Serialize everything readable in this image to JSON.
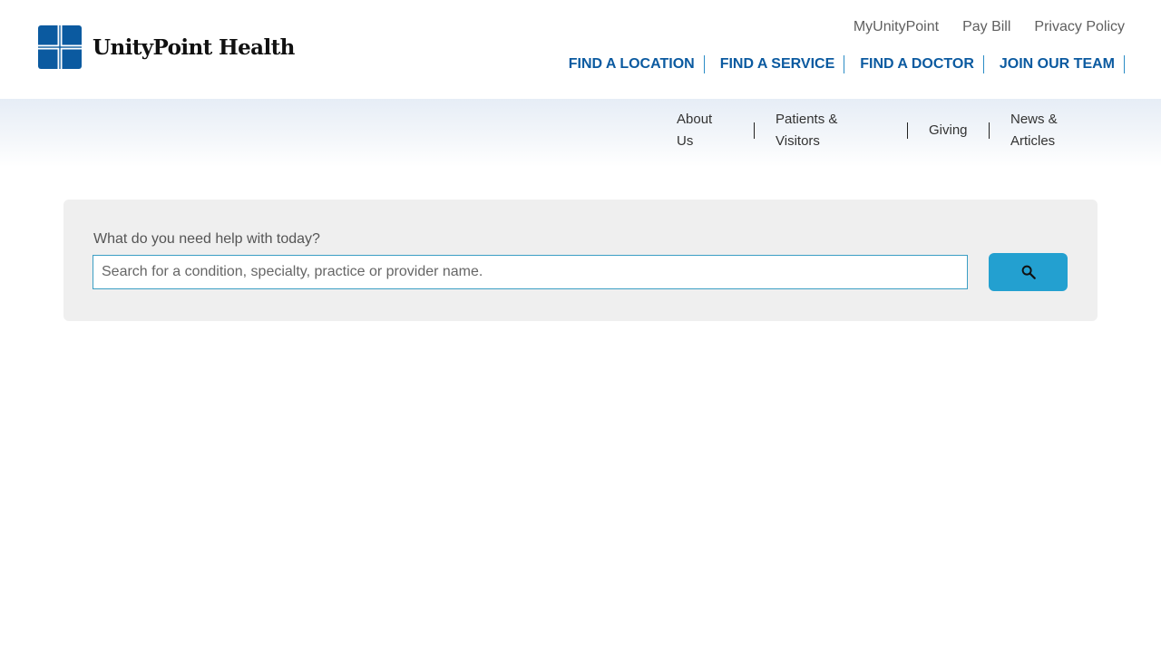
{
  "brand": {
    "name": "UnityPoint Health",
    "color": "#0b5aa0"
  },
  "utility_nav": [
    {
      "label": "MyUnityPoint"
    },
    {
      "label": "Pay Bill"
    },
    {
      "label": "Privacy Policy"
    }
  ],
  "primary_nav": [
    {
      "label": "FIND A LOCATION"
    },
    {
      "label": "FIND A SERVICE"
    },
    {
      "label": "FIND A DOCTOR"
    },
    {
      "label": "JOIN OUR TEAM"
    }
  ],
  "sub_nav": [
    {
      "line1": "About",
      "line2": "Us"
    },
    {
      "line1": "Patients &",
      "line2": "Visitors"
    },
    {
      "line1": "Giving",
      "line2": ""
    },
    {
      "line1": "News &",
      "line2": "Articles"
    }
  ],
  "search": {
    "label": "What do you need help with today?",
    "placeholder": "Search for a condition, specialty, practice or provider name.",
    "value": "",
    "button_icon": "search-icon",
    "button_color": "#23a0d0"
  }
}
